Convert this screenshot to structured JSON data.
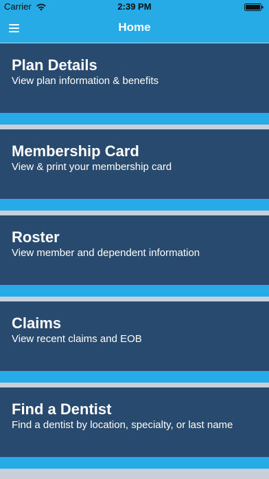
{
  "status_bar": {
    "carrier": "Carrier",
    "time": "2:39 PM",
    "wifi_icon": "wifi-icon",
    "battery_icon": "battery-icon"
  },
  "nav": {
    "title": "Home",
    "menu_icon": "hamburger-menu-icon"
  },
  "colors": {
    "accent": "#27abe6",
    "tile": "#294a6f",
    "background": "#c9cfd6"
  },
  "tiles": [
    {
      "title": "Plan Details",
      "subtitle": "View plan information & benefits"
    },
    {
      "title": "Membership Card",
      "subtitle": "View & print your membership card"
    },
    {
      "title": "Roster",
      "subtitle": "View member and dependent information"
    },
    {
      "title": "Claims",
      "subtitle": "View recent claims and EOB"
    },
    {
      "title": "Find a Dentist",
      "subtitle": "Find a dentist by location, specialty, or last name"
    }
  ]
}
